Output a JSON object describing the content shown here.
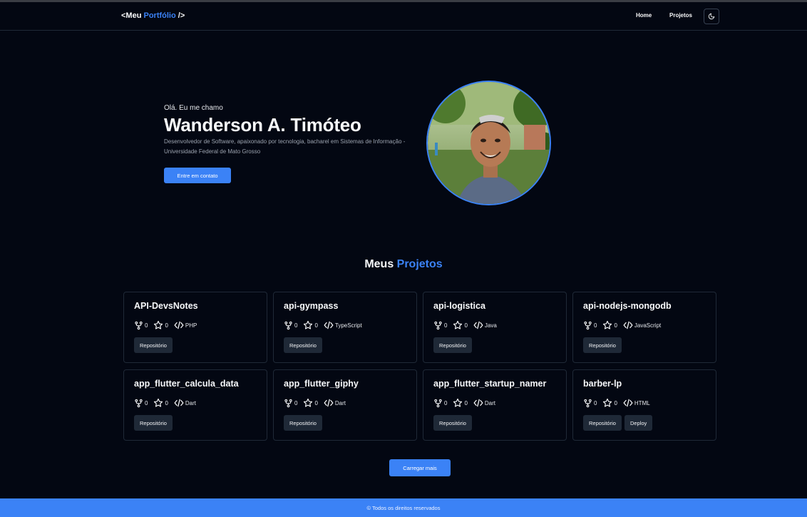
{
  "header": {
    "logo_prefix": "<Meu ",
    "logo_accent": "Portfólio",
    "logo_suffix": " />",
    "nav": [
      {
        "label": "Home"
      },
      {
        "label": "Projetos"
      }
    ],
    "theme_icon": "moon-icon"
  },
  "hero": {
    "greeting": "Olá. Eu me chamo",
    "name": "Wanderson A. Timóteo",
    "description": "Desenvolvedor de Software, apaixonado por tecnologia, bacharel em Sistemas de Informação - Universidade Federal de Mato Grosso",
    "contact_label": "Entre em contato"
  },
  "projects": {
    "title_prefix": "Meus ",
    "title_accent": "Projetos",
    "items": [
      {
        "name": "API-DevsNotes",
        "forks": "0",
        "stars": "0",
        "language": "PHP",
        "buttons": [
          "Repositório"
        ]
      },
      {
        "name": "api-gympass",
        "forks": "0",
        "stars": "0",
        "language": "TypeScript",
        "buttons": [
          "Repositório"
        ]
      },
      {
        "name": "api-logistica",
        "forks": "0",
        "stars": "0",
        "language": "Java",
        "buttons": [
          "Repositório"
        ]
      },
      {
        "name": "api-nodejs-mongodb",
        "forks": "0",
        "stars": "0",
        "language": "JavaScript",
        "buttons": [
          "Repositório"
        ]
      },
      {
        "name": "app_flutter_calcula_data",
        "forks": "0",
        "stars": "0",
        "language": "Dart",
        "buttons": [
          "Repositório"
        ]
      },
      {
        "name": "app_flutter_giphy",
        "forks": "0",
        "stars": "0",
        "language": "Dart",
        "buttons": [
          "Repositório"
        ]
      },
      {
        "name": "app_flutter_startup_namer",
        "forks": "0",
        "stars": "0",
        "language": "Dart",
        "buttons": [
          "Repositório"
        ]
      },
      {
        "name": "barber-lp",
        "forks": "0",
        "stars": "0",
        "language": "HTML",
        "buttons": [
          "Repositório",
          "Deploy"
        ]
      }
    ],
    "load_more_label": "Carregar mais"
  },
  "footer": {
    "text": "© Todos os direitos reservados"
  },
  "colors": {
    "background": "#030712",
    "accent": "#3b82f6",
    "card_border": "#1f2937",
    "button_dark": "#1f2937"
  }
}
